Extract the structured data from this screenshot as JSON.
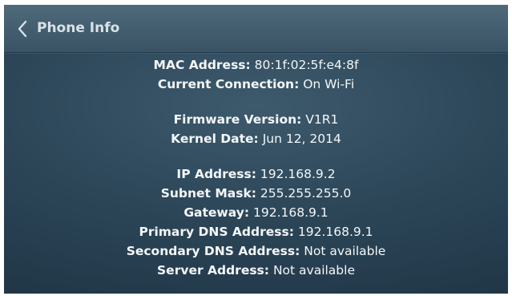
{
  "header": {
    "title": "Phone Info"
  },
  "groups": [
    {
      "rows": [
        {
          "label": "MAC Address:",
          "value": "80:1f:02:5f:e4:8f"
        },
        {
          "label": "Current Connection:",
          "value": "On Wi-Fi"
        }
      ]
    },
    {
      "rows": [
        {
          "label": "Firmware Version:",
          "value": "V1R1"
        },
        {
          "label": "Kernel Date:",
          "value": "Jun 12, 2014"
        }
      ]
    },
    {
      "rows": [
        {
          "label": "IP Address:",
          "value": "192.168.9.2"
        },
        {
          "label": "Subnet Mask:",
          "value": "255.255.255.0"
        },
        {
          "label": "Gateway:",
          "value": "192.168.9.1"
        },
        {
          "label": "Primary DNS Address:",
          "value": "192.168.9.1"
        },
        {
          "label": "Secondary DNS Address:",
          "value": "Not available"
        },
        {
          "label": "Server Address:",
          "value": "Not available"
        }
      ]
    }
  ],
  "icons": {
    "back": "chevron-left-icon"
  },
  "colors": {
    "header": "#425d6e",
    "background": "#2b4557",
    "text": "#ffffff"
  }
}
